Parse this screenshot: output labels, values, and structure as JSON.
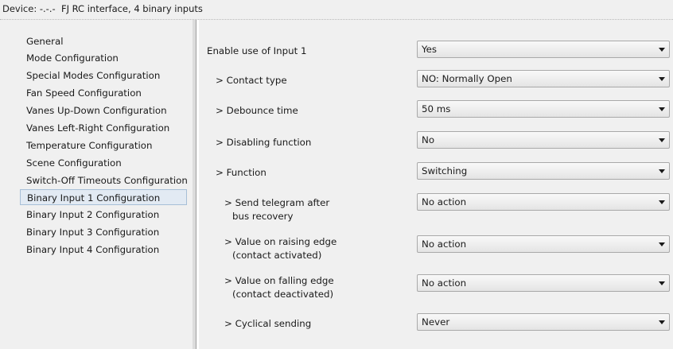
{
  "header": {
    "device_label": "Device:",
    "device_address": "-.-.-",
    "device_name": "FJ RC interface, 4 binary inputs"
  },
  "sidebar": {
    "items": [
      {
        "label": "General"
      },
      {
        "label": "Mode Configuration"
      },
      {
        "label": "Special Modes Configuration"
      },
      {
        "label": "Fan Speed Configuration"
      },
      {
        "label": "Vanes Up-Down Configuration"
      },
      {
        "label": "Vanes Left-Right Configuration"
      },
      {
        "label": "Temperature Configuration"
      },
      {
        "label": "Scene Configuration"
      },
      {
        "label": "Switch-Off Timeouts Configuration"
      },
      {
        "label": "Binary Input 1 Configuration",
        "selected": true
      },
      {
        "label": "Binary Input 2 Configuration"
      },
      {
        "label": "Binary Input 3 Configuration"
      },
      {
        "label": "Binary Input 4 Configuration"
      }
    ]
  },
  "params": [
    {
      "label": "Enable use of Input 1",
      "value": "Yes"
    },
    {
      "label": "> Contact type",
      "value": "NO: Normally Open"
    },
    {
      "label": "> Debounce time",
      "value": "50 ms"
    },
    {
      "label": "> Disabling function",
      "value": "No"
    },
    {
      "label": "> Function",
      "value": "Switching"
    },
    {
      "label": "> Send telegram after",
      "label2": "bus recovery",
      "value": "No action"
    },
    {
      "label": "> Value on raising edge",
      "label2": "(contact activated)",
      "value": "No action"
    },
    {
      "label": "> Value on falling edge",
      "label2": "(contact deactivated)",
      "value": "No action"
    },
    {
      "label": "> Cyclical sending",
      "value": "Never"
    }
  ],
  "icons": {
    "dropdown": "chevron-down-icon"
  }
}
